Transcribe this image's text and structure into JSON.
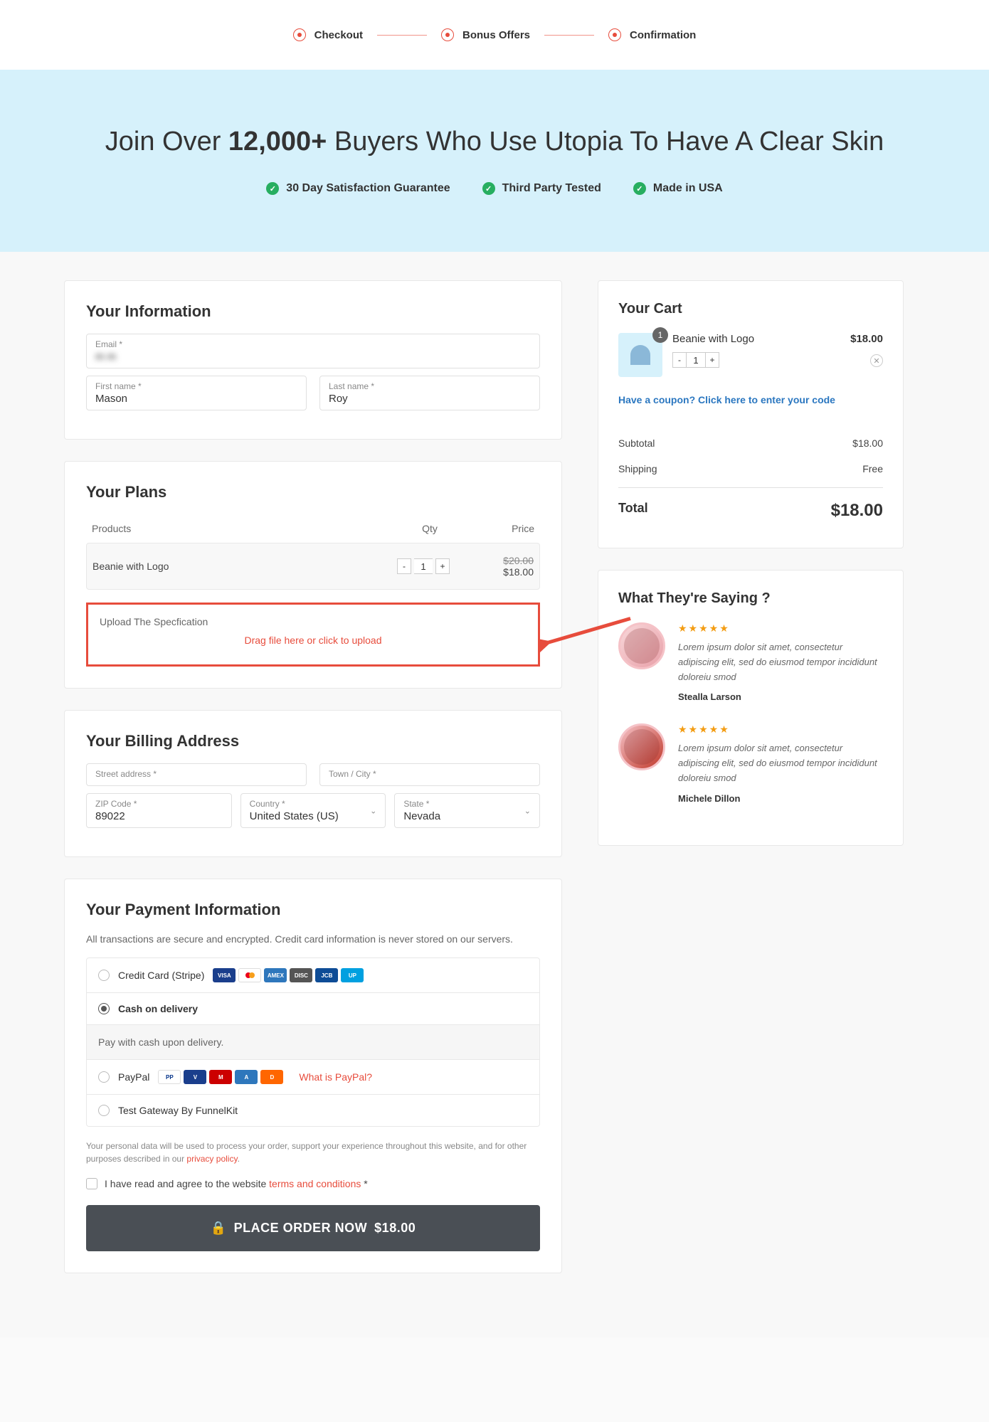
{
  "progress": {
    "steps": [
      "Checkout",
      "Bonus Offers",
      "Confirmation"
    ]
  },
  "hero": {
    "title_pre": "Join Over ",
    "title_bold": "12,000+ ",
    "title_post": "Buyers Who Use Utopia To Have A Clear Skin",
    "features": [
      "30 Day Satisfaction Guarantee",
      "Third Party Tested",
      "Made in USA"
    ]
  },
  "info": {
    "heading": "Your Information",
    "email_label": "Email *",
    "email_value": "m                m",
    "first_label": "First name *",
    "first_value": "Mason",
    "last_label": "Last name *",
    "last_value": "Roy"
  },
  "plans": {
    "heading": "Your Plans",
    "col_products": "Products",
    "col_qty": "Qty",
    "col_price": "Price",
    "item_name": "Beanie with Logo",
    "item_qty": "1",
    "price_old": "$20.00",
    "price_new": "$18.00",
    "upload_label": "Upload The Specfication",
    "upload_placeholder": "Drag file here or click to upload"
  },
  "billing": {
    "heading": "Your Billing Address",
    "street_label": "Street address *",
    "street_value": "  ",
    "town_label": "Town / City *",
    "town_value": "  ",
    "zip_label": "ZIP Code *",
    "zip_value": "89022",
    "country_label": "Country *",
    "country_value": "United States (US)",
    "state_label": "State *",
    "state_value": "Nevada"
  },
  "payment": {
    "heading": "Your Payment Information",
    "note": "All transactions are secure and encrypted. Credit card information is never stored on our servers.",
    "opt_cc": "Credit Card (Stripe)",
    "opt_cod": "Cash on delivery",
    "cod_desc": "Pay with cash upon delivery.",
    "opt_paypal": "PayPal",
    "paypal_link": "What is PayPal?",
    "opt_test": "Test Gateway By FunnelKit",
    "privacy_pre": "Your personal data will be used to process your order, support your experience throughout this website, and for other purposes described in our ",
    "privacy_link": "privacy policy",
    "agree_pre": "I have read and agree to the website ",
    "agree_link": "terms and conditions",
    "agree_star": " *",
    "button_label": "PLACE ORDER NOW",
    "button_price": "$18.00"
  },
  "cart": {
    "heading": "Your Cart",
    "item_name": "Beanie with Logo",
    "item_badge": "1",
    "item_qty": "1",
    "item_price": "$18.00",
    "coupon_text": "Have a coupon? Click here to enter your code",
    "subtotal_label": "Subtotal",
    "subtotal_value": "$18.00",
    "shipping_label": "Shipping",
    "shipping_value": "Free",
    "total_label": "Total",
    "total_value": "$18.00"
  },
  "testimonials": {
    "heading": "What They're Saying ?",
    "items": [
      {
        "text": "Lorem ipsum dolor sit amet, consectetur adipiscing elit, sed do eiusmod tempor incididunt doloreiu smod",
        "name": "Stealla Larson"
      },
      {
        "text": "Lorem ipsum dolor sit amet, consectetur adipiscing elit, sed do eiusmod tempor incididunt doloreiu smod",
        "name": "Michele Dillon"
      }
    ]
  }
}
